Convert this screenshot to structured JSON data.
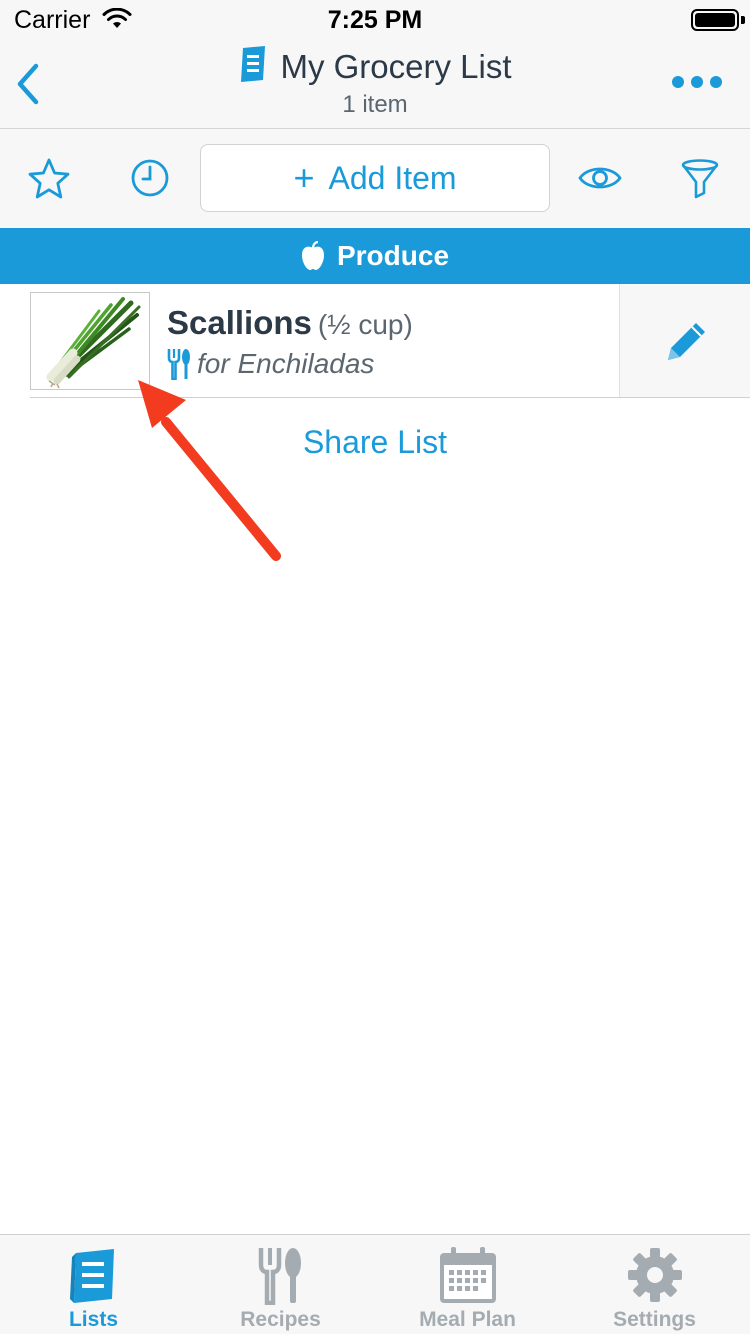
{
  "status_bar": {
    "carrier": "Carrier",
    "time": "7:25 PM"
  },
  "nav": {
    "title": "My Grocery List",
    "subtitle": "1 item"
  },
  "toolbar": {
    "add_item_label": "Add Item"
  },
  "category": {
    "name": "Produce"
  },
  "item": {
    "name": "Scallions",
    "quantity": "(½ cup)",
    "recipe": "for Enchiladas"
  },
  "share_label": "Share List",
  "tabs": [
    {
      "label": "Lists",
      "icon": "lists-icon",
      "active": true
    },
    {
      "label": "Recipes",
      "icon": "fork-spoon-icon",
      "active": false
    },
    {
      "label": "Meal Plan",
      "icon": "calendar-icon",
      "active": false
    },
    {
      "label": "Settings",
      "icon": "gear-icon",
      "active": false
    }
  ],
  "colors": {
    "accent": "#1a9ad9",
    "arrow": "#f23b1f",
    "tab_inactive": "#a4acb1"
  }
}
